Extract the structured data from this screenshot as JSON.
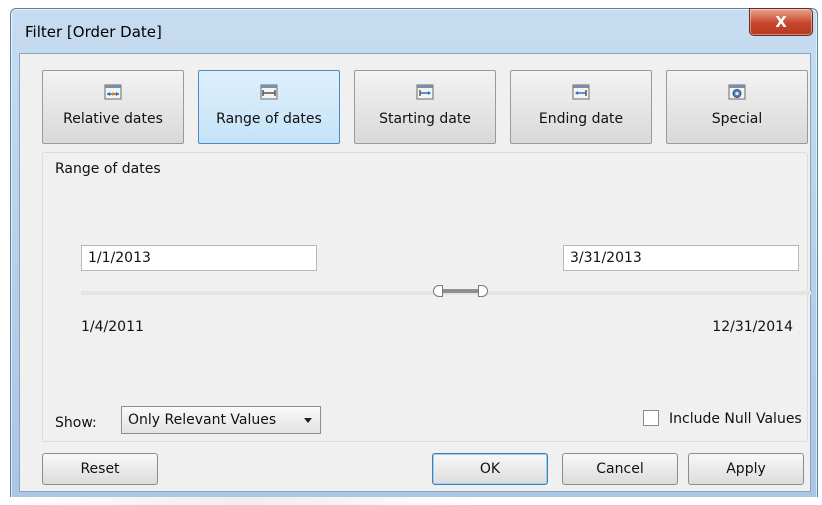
{
  "window": {
    "title": "Filter [Order Date]",
    "close_glyph": "X"
  },
  "modes": [
    {
      "label": "Relative dates",
      "icon": "relative-dates-icon",
      "selected": false
    },
    {
      "label": "Range of dates",
      "icon": "range-of-dates-icon",
      "selected": true
    },
    {
      "label": "Starting date",
      "icon": "starting-date-icon",
      "selected": false
    },
    {
      "label": "Ending date",
      "icon": "ending-date-icon",
      "selected": false
    },
    {
      "label": "Special",
      "icon": "special-icon",
      "selected": false
    }
  ],
  "range": {
    "group_label": "Range of dates",
    "start_value": "1/1/2013",
    "end_value": "3/31/2013",
    "min_label": "1/4/2011",
    "max_label": "12/31/2014"
  },
  "show": {
    "label": "Show:",
    "selected": "Only Relevant Values"
  },
  "include_null": {
    "label": "Include Null Values",
    "checked": false
  },
  "buttons": {
    "reset": "Reset",
    "ok": "OK",
    "cancel": "Cancel",
    "apply": "Apply"
  },
  "colors": {
    "selected_mode_bg": "#c5e3f8",
    "selected_mode_border": "#4b8ac6",
    "close_button": "#c8452b"
  }
}
